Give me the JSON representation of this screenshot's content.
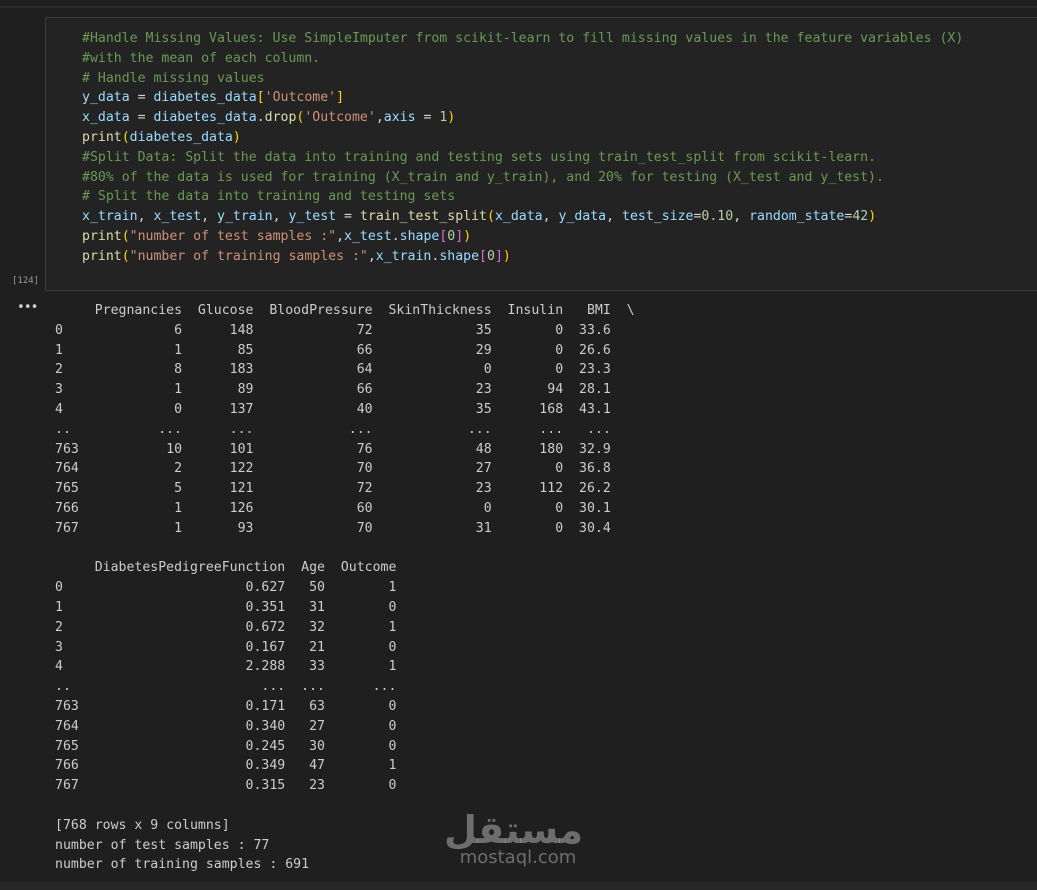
{
  "cell": {
    "execution_count": "[124]",
    "code": [
      [
        {
          "t": "#Handle Missing Values: Use SimpleImputer from scikit-learn to fill missing values in the feature variables (X)",
          "c": "c-comment"
        }
      ],
      [
        {
          "t": "#with the mean of each column.",
          "c": "c-comment"
        }
      ],
      [
        {
          "t": "# Handle missing values",
          "c": "c-comment"
        }
      ],
      [
        {
          "t": "y_data",
          "c": "c-var"
        },
        {
          "t": " = ",
          "c": "c-op"
        },
        {
          "t": "diabetes_data",
          "c": "c-var"
        },
        {
          "t": "[",
          "c": "c-br1"
        },
        {
          "t": "'Outcome'",
          "c": "c-str"
        },
        {
          "t": "]",
          "c": "c-br1"
        }
      ],
      [
        {
          "t": "x_data",
          "c": "c-var"
        },
        {
          "t": " = ",
          "c": "c-op"
        },
        {
          "t": "diabetes_data",
          "c": "c-var"
        },
        {
          "t": ".",
          "c": "c-op"
        },
        {
          "t": "drop",
          "c": "c-fn"
        },
        {
          "t": "(",
          "c": "c-br1"
        },
        {
          "t": "'Outcome'",
          "c": "c-str"
        },
        {
          "t": ",",
          "c": "c-op"
        },
        {
          "t": "axis",
          "c": "c-var"
        },
        {
          "t": " = ",
          "c": "c-op"
        },
        {
          "t": "1",
          "c": "c-num"
        },
        {
          "t": ")",
          "c": "c-br1"
        }
      ],
      [
        {
          "t": "print",
          "c": "c-fn"
        },
        {
          "t": "(",
          "c": "c-br1"
        },
        {
          "t": "diabetes_data",
          "c": "c-var"
        },
        {
          "t": ")",
          "c": "c-br1"
        }
      ],
      [
        {
          "t": "#Split Data: Split the data into training and testing sets using train_test_split from scikit-learn.",
          "c": "c-comment"
        }
      ],
      [
        {
          "t": "#80% of the data is used for training (X_train and y_train), and 20% for testing (X_test and y_test).",
          "c": "c-comment"
        }
      ],
      [
        {
          "t": "# Split the data into training and testing sets",
          "c": "c-comment"
        }
      ],
      [
        {
          "t": "x_train",
          "c": "c-var"
        },
        {
          "t": ", ",
          "c": "c-op"
        },
        {
          "t": "x_test",
          "c": "c-var"
        },
        {
          "t": ", ",
          "c": "c-op"
        },
        {
          "t": "y_train",
          "c": "c-var"
        },
        {
          "t": ", ",
          "c": "c-op"
        },
        {
          "t": "y_test",
          "c": "c-var"
        },
        {
          "t": " = ",
          "c": "c-op"
        },
        {
          "t": "train_test_split",
          "c": "c-fn"
        },
        {
          "t": "(",
          "c": "c-br1"
        },
        {
          "t": "x_data",
          "c": "c-var"
        },
        {
          "t": ", ",
          "c": "c-op"
        },
        {
          "t": "y_data",
          "c": "c-var"
        },
        {
          "t": ", ",
          "c": "c-op"
        },
        {
          "t": "test_size",
          "c": "c-var"
        },
        {
          "t": "=",
          "c": "c-op"
        },
        {
          "t": "0.10",
          "c": "c-num"
        },
        {
          "t": ", ",
          "c": "c-op"
        },
        {
          "t": "random_state",
          "c": "c-var"
        },
        {
          "t": "=",
          "c": "c-op"
        },
        {
          "t": "42",
          "c": "c-num"
        },
        {
          "t": ")",
          "c": "c-br1"
        }
      ],
      [
        {
          "t": "print",
          "c": "c-fn"
        },
        {
          "t": "(",
          "c": "c-br1"
        },
        {
          "t": "\"number of test samples :\"",
          "c": "c-str"
        },
        {
          "t": ",",
          "c": "c-op"
        },
        {
          "t": "x_test",
          "c": "c-var"
        },
        {
          "t": ".",
          "c": "c-op"
        },
        {
          "t": "shape",
          "c": "c-var"
        },
        {
          "t": "[",
          "c": "c-br2"
        },
        {
          "t": "0",
          "c": "c-num"
        },
        {
          "t": "]",
          "c": "c-br2"
        },
        {
          "t": ")",
          "c": "c-br1"
        }
      ],
      [
        {
          "t": "print",
          "c": "c-fn"
        },
        {
          "t": "(",
          "c": "c-br1"
        },
        {
          "t": "\"number of training samples :\"",
          "c": "c-str"
        },
        {
          "t": ",",
          "c": "c-op"
        },
        {
          "t": "x_train",
          "c": "c-var"
        },
        {
          "t": ".",
          "c": "c-op"
        },
        {
          "t": "shape",
          "c": "c-var"
        },
        {
          "t": "[",
          "c": "c-br2"
        },
        {
          "t": "0",
          "c": "c-num"
        },
        {
          "t": "]",
          "c": "c-br2"
        },
        {
          "t": ")",
          "c": "c-br1"
        }
      ]
    ]
  },
  "output": {
    "toggle_label": "•••",
    "lines": [
      "     Pregnancies  Glucose  BloodPressure  SkinThickness  Insulin   BMI  \\",
      "0              6      148             72             35        0  33.6",
      "1              1       85             66             29        0  26.6",
      "2              8      183             64              0        0  23.3",
      "3              1       89             66             23       94  28.1",
      "4              0      137             40             35      168  43.1",
      "..           ...      ...            ...            ...      ...   ...",
      "763           10      101             76             48      180  32.9",
      "764            2      122             70             27        0  36.8",
      "765            5      121             72             23      112  26.2",
      "766            1      126             60              0        0  30.1",
      "767            1       93             70             31        0  30.4",
      "",
      "     DiabetesPedigreeFunction  Age  Outcome",
      "0                       0.627   50        1",
      "1                       0.351   31        0",
      "2                       0.672   32        1",
      "3                       0.167   21        0",
      "4                       2.288   33        1",
      "..                        ...  ...      ...",
      "763                     0.171   63        0",
      "764                     0.340   27        0",
      "765                     0.245   30        0",
      "766                     0.349   47        1",
      "767                     0.315   23        0",
      "",
      "[768 rows x 9 columns]",
      "number of test samples : 77",
      "number of training samples : 691"
    ]
  },
  "watermark": {
    "arabic": "مستقل",
    "latin": "mostaql.com"
  }
}
